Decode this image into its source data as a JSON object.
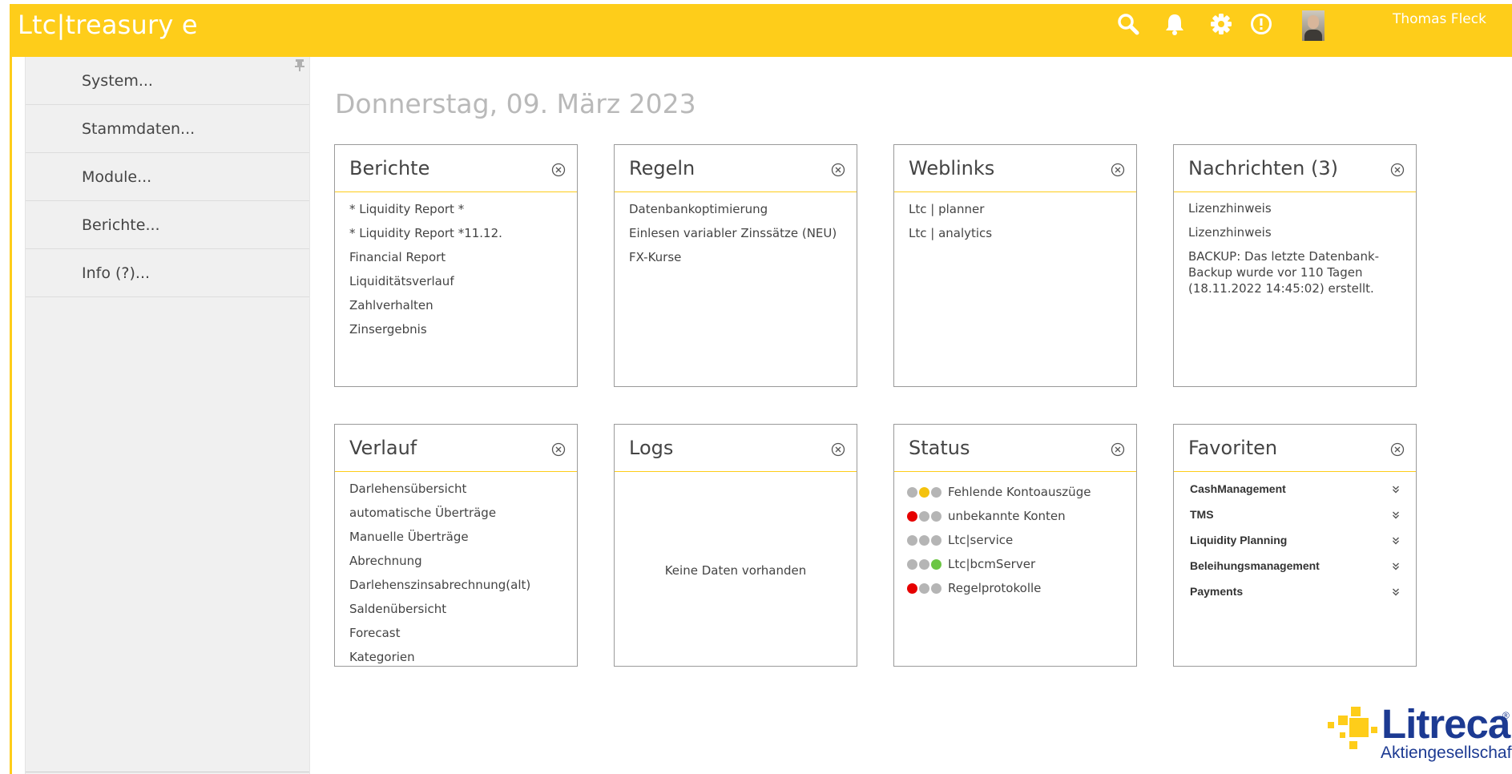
{
  "header": {
    "app_title": "Ltc|treasury e",
    "user_name": "Thomas Fleck",
    "icons": [
      "search-icon",
      "bell-icon",
      "gear-icon",
      "alert-icon",
      "avatar"
    ],
    "accent_color": "#fecd1a"
  },
  "sidebar": {
    "items": [
      {
        "label": "System..."
      },
      {
        "label": "Stammdaten..."
      },
      {
        "label": "Module..."
      },
      {
        "label": "Berichte..."
      },
      {
        "label": "Info (?)..."
      }
    ]
  },
  "main": {
    "date": "Donnerstag, 09. März 2023",
    "cards": {
      "berichte": {
        "title": "Berichte",
        "items": [
          "* Liquidity Report *",
          "* Liquidity Report *11.12.",
          "Financial Report",
          "Liquiditätsverlauf",
          "Zahlverhalten",
          "Zinsergebnis"
        ]
      },
      "regeln": {
        "title": "Regeln",
        "items": [
          "Datenbankoptimierung",
          "Einlesen variabler Zinssätze (NEU)",
          "FX-Kurse"
        ]
      },
      "weblinks": {
        "title": "Weblinks",
        "items": [
          "Ltc | planner",
          "Ltc | analytics"
        ]
      },
      "nachrichten": {
        "title": "Nachrichten (3)",
        "items": [
          "Lizenzhinweis",
          "Lizenzhinweis",
          "BACKUP: Das letzte Datenbank-Backup wurde vor 110 Tagen (18.11.2022 14:45:02) erstellt."
        ]
      },
      "verlauf": {
        "title": "Verlauf",
        "items": [
          "Darlehensübersicht",
          "automatische Überträge",
          "Manuelle Überträge",
          "Abrechnung",
          "Darlehenszinsabrechnung(alt)",
          "Saldenübersicht",
          "Forecast",
          "Kategorien"
        ]
      },
      "logs": {
        "title": "Logs",
        "empty_text": "Keine Daten vorhanden"
      },
      "status": {
        "title": "Status",
        "items": [
          {
            "label": "Fehlende Kontoauszüge",
            "lights": [
              "gray",
              "yellow",
              "gray"
            ]
          },
          {
            "label": "unbekannte Konten",
            "lights": [
              "red",
              "gray",
              "gray"
            ]
          },
          {
            "label": "Ltc|service",
            "lights": [
              "gray",
              "gray",
              "gray"
            ]
          },
          {
            "label": "Ltc|bcmServer",
            "lights": [
              "gray",
              "gray",
              "green"
            ]
          },
          {
            "label": "Regelprotokolle",
            "lights": [
              "red",
              "gray",
              "gray"
            ]
          }
        ],
        "colors": {
          "gray": "#b5b5b5",
          "yellow": "#f4c20d",
          "red": "#e60000",
          "green": "#6cc644"
        }
      },
      "favoriten": {
        "title": "Favoriten",
        "items": [
          "CashManagement",
          "TMS",
          "Liquidity Planning",
          "Beleihungsmanagement",
          "Payments"
        ]
      }
    }
  },
  "logo": {
    "name": "Litreca",
    "subtitle": "Aktiengesellschaft",
    "registered": "®",
    "colors": {
      "blue": "#1c3a92",
      "yellow": "#fecd1a"
    }
  }
}
